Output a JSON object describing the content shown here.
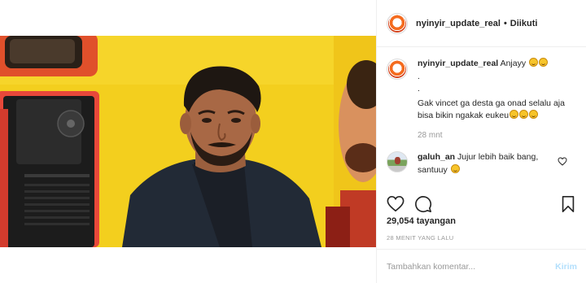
{
  "header": {
    "username": "nyinyir_update_real",
    "separator": "•",
    "follow_status": "Diikuti"
  },
  "caption": {
    "username": "nyinyir_update_real",
    "line1": "Anjayy",
    "line2": ".",
    "line3": ".",
    "line4": "Gak vincet ga desta ga onad selalu aja bisa bikin ngakak eukeu",
    "time": "28 mnt"
  },
  "reply": {
    "username": "galuh_an",
    "text": "Jujur lebih baik bang, santuuy"
  },
  "stats": {
    "views": "29,054 tayangan",
    "posted": "28 MENIT YANG LALU"
  },
  "composer": {
    "placeholder": "Tambahkan komentar...",
    "post_label": "Kirim"
  },
  "icons": {
    "like": "heart-icon",
    "comment": "comment-bubble-icon",
    "save": "bookmark-icon",
    "reply_like": "small-heart-icon"
  },
  "colors": {
    "text": "#262626",
    "muted": "#999999",
    "border": "#efefef",
    "post_button_disabled": "#b2dffc",
    "video_background": "#f3cf1e"
  }
}
